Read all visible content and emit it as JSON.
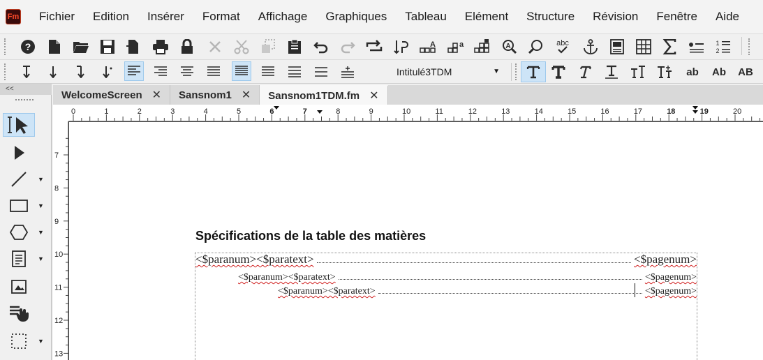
{
  "app": {
    "logo_text": "Fm",
    "menu": [
      "Fichier",
      "Edition",
      "Insérer",
      "Format",
      "Affichage",
      "Graphiques",
      "Tableau",
      "Elément",
      "Structure",
      "Révision",
      "Fenêtre",
      "Aide"
    ]
  },
  "toolbar": {
    "icons_row1": [
      "help-icon",
      "new-document-icon",
      "open-folder-icon",
      "save-icon",
      "save-as-icon",
      "print-icon",
      "lock-icon",
      "close-x-icon",
      "cut-icon",
      "copy-icon",
      "paste-icon",
      "undo-icon",
      "redo-icon",
      "repeat-icon",
      "flip-icon",
      "char-designer-icon",
      "para-designer-icon",
      "table-designer-icon",
      "find-replace-icon",
      "search-icon",
      "spelling-icon",
      "anchor-icon",
      "reference-page-icon",
      "table-icon",
      "sum-icon",
      "bullet-list-icon",
      "numbered-list-icon"
    ],
    "paragraph_format": "Intitulé3TDM"
  },
  "tabs": [
    {
      "label": "WelcomeScreen",
      "active": false
    },
    {
      "label": "Sansnom1",
      "active": false
    },
    {
      "label": "Sansnom1TDM.fm",
      "active": true
    }
  ],
  "ruler": {
    "h_labels": [
      "0",
      "1",
      "2",
      "3",
      "4",
      "5",
      "6",
      "7",
      "8",
      "9",
      "10",
      "11",
      "12",
      "13",
      "14",
      "15",
      "16",
      "17",
      "18",
      "19",
      "20"
    ],
    "v_labels": [
      "7",
      "8",
      "9",
      "10",
      "11",
      "12",
      "13"
    ]
  },
  "document": {
    "heading": "Spécifications de la table des matières",
    "toc_lines": [
      {
        "left": "<$paranum><$paratext>",
        "right": "<$pagenum>"
      },
      {
        "left": "<$paranum><$paratext>",
        "right": "<$pagenum>"
      },
      {
        "left": "<$paranum><$paratext>",
        "right": "<$pagenum>"
      }
    ]
  },
  "format_buttons": [
    "ab",
    "Ab",
    "AB"
  ]
}
